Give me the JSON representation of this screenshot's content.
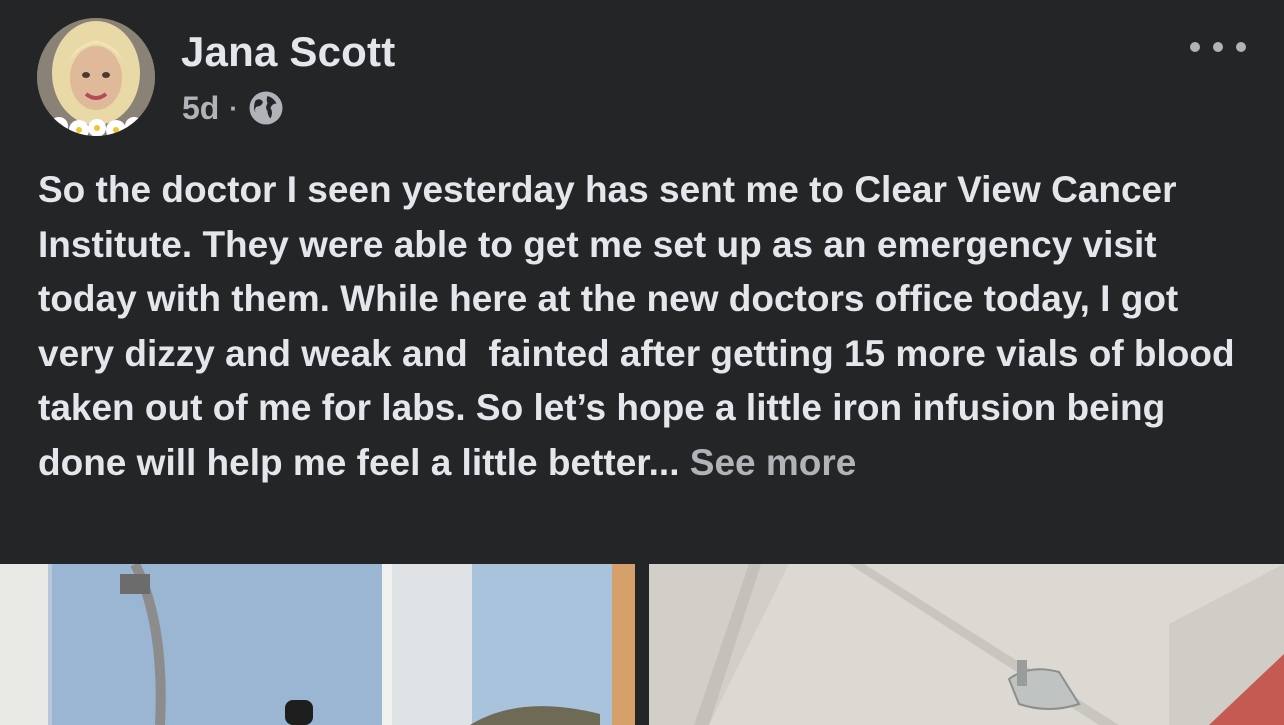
{
  "post": {
    "author_name": "Jana Scott",
    "timestamp": "5d",
    "separator": "·",
    "audience_icon": "globe-icon",
    "text": "So the doctor I seen yesterday has sent me to Clear View Cancer Institute. They were able to get me set up as an emergency visit today with them. While here at the new doctors office today, I got very dizzy and weak and  fainted after getting 15 more vials of blood taken out of me for labs. So let’s hope a little iron infusion being done will help me feel a little better...",
    "see_more_label": " See more",
    "more_icon": "more-horizontal-icon"
  },
  "colors": {
    "background": "#242526",
    "primary_text": "#e4e6eb",
    "secondary_text": "#b0b3b8"
  }
}
